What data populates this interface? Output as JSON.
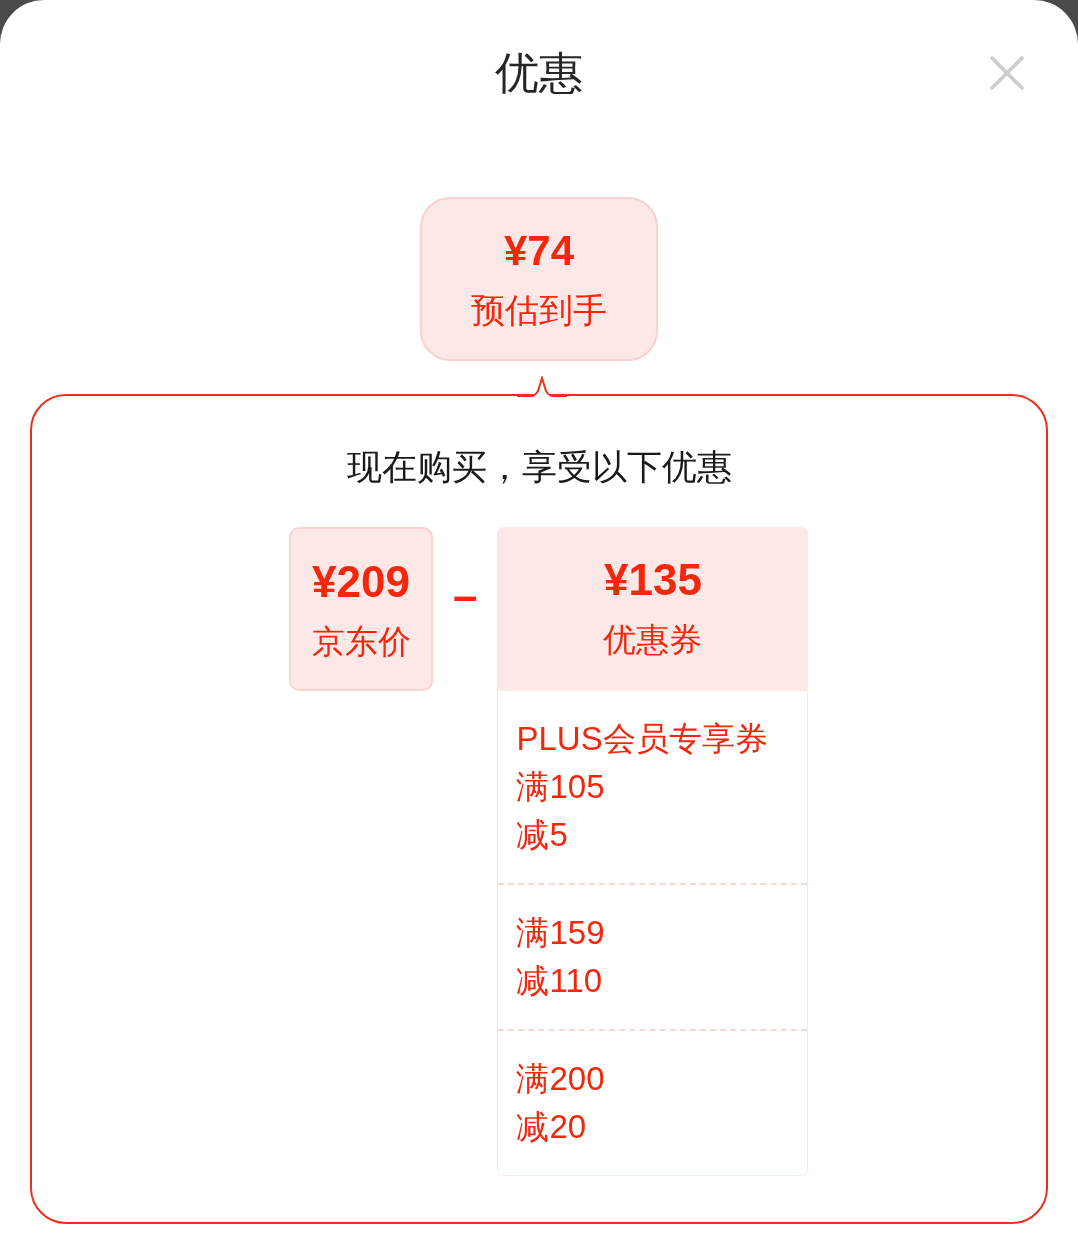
{
  "header": {
    "title": "优惠"
  },
  "estimate": {
    "price": "¥74",
    "label": "预估到手"
  },
  "panel": {
    "heading": "现在购买，享受以下优惠",
    "terms": [
      {
        "kind": "price",
        "amount": "¥209",
        "label": "京东价"
      },
      {
        "kind": "coupon",
        "operator": "–",
        "amount": "¥135",
        "label": "优惠券",
        "coupons": [
          {
            "title": "PLUS会员专享券",
            "condition": "满105",
            "discount": "减5"
          },
          {
            "condition": "满159",
            "discount": "减110"
          },
          {
            "condition": "满200",
            "discount": "减20"
          }
        ]
      }
    ]
  }
}
